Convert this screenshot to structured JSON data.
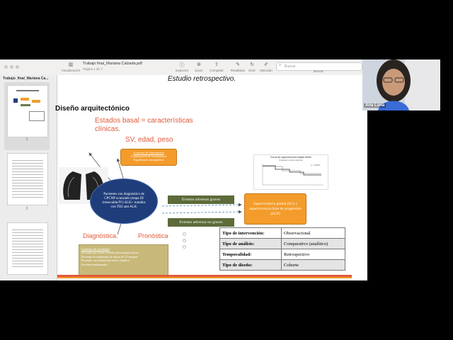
{
  "app": {
    "doc_title": "Trabajo final_Mariana Calzada.pdf",
    "page_info": "Página 1 de 7",
    "sidebar_title": "Trabajo_final_Mariana Ca...",
    "search_placeholder": "Buscar",
    "toolbar": {
      "view_label": "Visualización",
      "inspector_label": "Inspector",
      "zoom_label": "Zoom",
      "share_label": "Compartir",
      "highlight_label": "Resaltado",
      "rotate_label": "Girar",
      "markup_label": "Marcado",
      "search_label": "Buscar"
    },
    "pages": [
      {
        "label": "1"
      },
      {
        "label": "2"
      },
      {
        "label": ""
      }
    ]
  },
  "slide": {
    "retro_text": "Estudio retrospectivo.",
    "heading": "Diseño arquitectónico",
    "baseline_text": "Estados basal = características clínicas.",
    "sv_text": "SV, edad, peso",
    "inclusion_title": "Criterios de eliminación",
    "inclusion_line1": "Continuación de tratamientos",
    "inclusion_line2": "Expedientes incompletos",
    "oval_text": "Pacientes con diagnóstico de CPCNP avanzado (etapa III irresecable/IV) ALK+ tratados con TKI anti ALK",
    "adverse_grave": "Eventos adversos graves",
    "adverse_no_grave": "Eventos adversos no graves",
    "survival_text": "Supervivencia global (SG) y supervivencia libre de progresión (SLP)",
    "km_title": "Curva de supervivencia Kaplan-Meier",
    "km_subtitle": "Cualquier evento adverso",
    "km_legend": "p = 0.000",
    "diagnostica": "Diagnóstica.",
    "pronostica": "Pronóstica",
    "exclusion_title": "Criterios de exclusión",
    "exclusion_lines": [
      "Pacientes que hayan recibido quimioterapia previa",
      "Pacientes en tratamiento de menos de 12 semanas",
      "Pacientes con enfermedad renal o hepática",
      "Pacientes embarazadas"
    ],
    "table": [
      {
        "k": "Tipo de intervención:",
        "v": "Observacional"
      },
      {
        "k": "Tipo de análisis:",
        "v": "Comparativo (analítico)"
      },
      {
        "k": "Temporalidad:",
        "v": "Retrospectivo"
      },
      {
        "k": "Tipo de diseño:",
        "v": "Cohorte"
      }
    ]
  },
  "video": {
    "name": "Ana Luna"
  },
  "colors": {
    "accent_red": "#e0593a",
    "orange_box": "#f39c2b",
    "navy": "#1f3d7a",
    "olive": "#5d6b3a",
    "khaki": "#c8b97a"
  }
}
